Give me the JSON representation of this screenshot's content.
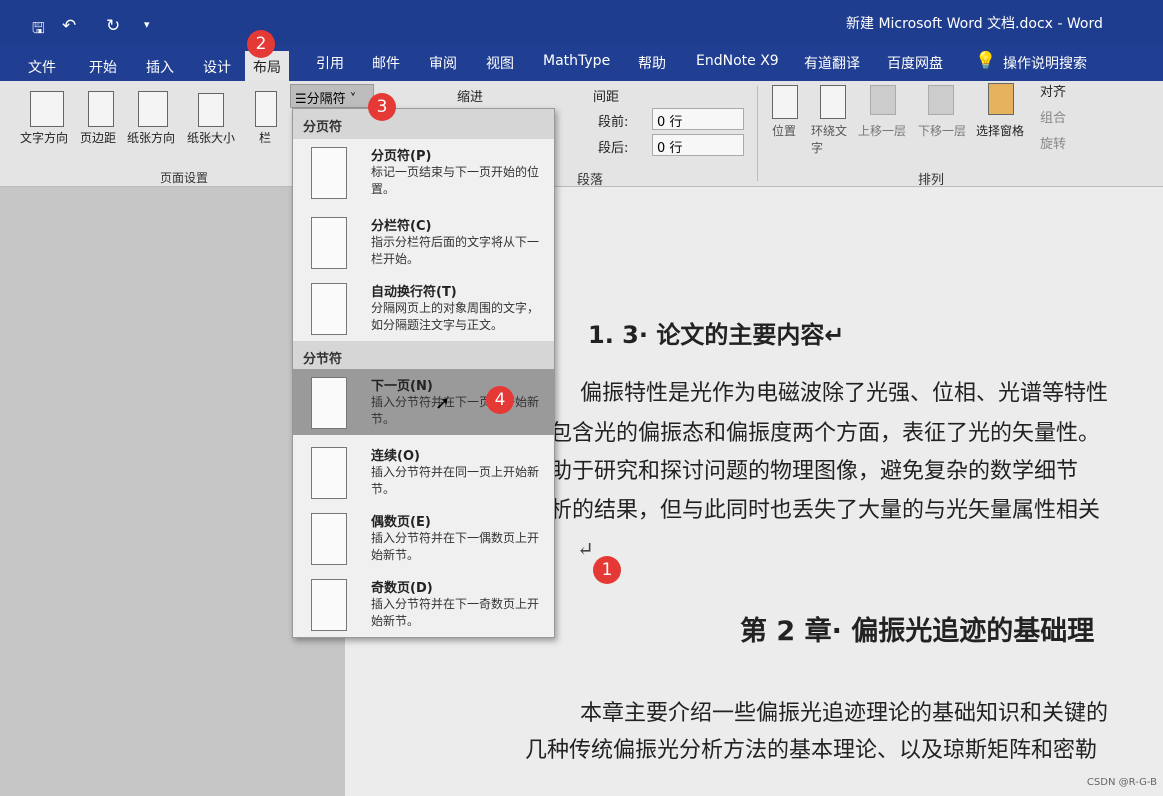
{
  "window": {
    "title": "新建 Microsoft Word 文档.docx  -  Word"
  },
  "qat": {
    "save": "save-icon",
    "undo": "undo-icon",
    "redo": "redo-icon",
    "customize": "▾"
  },
  "tabs": [
    "文件",
    "开始",
    "插入",
    "设计",
    "布局",
    "引用",
    "邮件",
    "审阅",
    "视图",
    "MathType",
    "帮助",
    "EndNote X9",
    "有道翻译",
    "百度网盘"
  ],
  "active_tab": "布局",
  "tell_me": "操作说明搜索",
  "ribbon": {
    "page_setup": {
      "buttons": [
        "文字方向",
        "页边距",
        "纸张方向",
        "纸张大小",
        "栏"
      ],
      "group": "页面设置"
    },
    "breaks_button": "分隔符",
    "indent_label": "缩进",
    "spacing_label": "间距",
    "before_label": "段前:",
    "before_value": "0 行",
    "after_label": "段后:",
    "after_value": "0 行",
    "paragraph_group": "段落",
    "arrange": {
      "buttons": [
        "位置",
        "环绕文字",
        "上移一层",
        "下移一层",
        "选择窗格"
      ],
      "align": "对齐",
      "group_btn": "组合",
      "rotate": "旋转",
      "group": "排列"
    }
  },
  "menu": {
    "page_breaks_header": "分页符",
    "section_breaks_header": "分节符",
    "items": [
      {
        "title": "分页符(P)",
        "desc": "标记一页结束与下一页开始的位置。"
      },
      {
        "title": "分栏符(C)",
        "desc": "指示分栏符后面的文字将从下一栏开始。"
      },
      {
        "title": "自动换行符(T)",
        "desc": "分隔网页上的对象周围的文字，如分隔题注文字与正文。"
      },
      {
        "title": "下一页(N)",
        "desc": "插入分节符并在下一页上开始新节。"
      },
      {
        "title": "连续(O)",
        "desc": "插入分节符并在同一页上开始新节。"
      },
      {
        "title": "偶数页(E)",
        "desc": "插入分节符并在下一偶数页上开始新节。"
      },
      {
        "title": "奇数页(D)",
        "desc": "插入分节符并在下一奇数页上开始新节。"
      }
    ],
    "highlighted": "下一页(N)"
  },
  "document": {
    "heading": "1. 3· 论文的主要内容↵",
    "para1": [
      "偏振特性是光作为电磁波除了光强、位相、光谱等特性",
      "包含光的偏振态和偏振度两个方面，表征了光的矢量性。",
      "助于研究和探讨问题的物理图像，避免复杂的数学细节",
      "析的结果，但与此同时也丢失了大量的与光矢量属性相关"
    ],
    "cursor_mark": "↵",
    "chapter": "第 2 章· 偏振光追迹的基础理",
    "para2": [
      "本章主要介绍一些偏振光追迹理论的基础知识和关键的",
      "几种传统偏振光分析方法的基本理论、以及琼斯矩阵和密勒"
    ]
  },
  "annotations": [
    "1",
    "2",
    "3",
    "4"
  ],
  "watermark": "CSDN @R-G-B",
  "colors": {
    "titlebar": "#1e3d8f",
    "badge": "#e53935",
    "highlight": "#9a9a9a"
  }
}
